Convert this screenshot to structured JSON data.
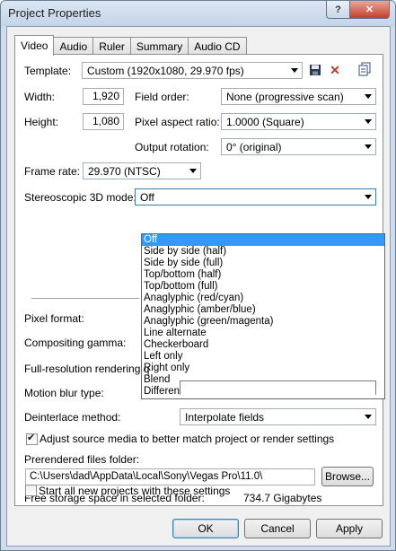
{
  "window": {
    "title": "Project Properties"
  },
  "tabs": [
    {
      "label": "Video",
      "active": true
    },
    {
      "label": "Audio",
      "active": false
    },
    {
      "label": "Ruler",
      "active": false
    },
    {
      "label": "Summary",
      "active": false
    },
    {
      "label": "Audio CD",
      "active": false
    }
  ],
  "video": {
    "template_label": "Template:",
    "template_value": "Custom (1920x1080, 29.970 fps)",
    "width_label": "Width:",
    "width_value": "1,920",
    "height_label": "Height:",
    "height_value": "1,080",
    "field_order_label": "Field order:",
    "field_order_value": "None (progressive scan)",
    "pixel_aspect_label": "Pixel aspect ratio:",
    "pixel_aspect_value": "1.0000 (Square)",
    "output_rotation_label": "Output rotation:",
    "output_rotation_value": "0° (original)",
    "frame_rate_label": "Frame rate:",
    "frame_rate_value": "29.970 (NTSC)",
    "stereo_label": "Stereoscopic 3D mode:",
    "stereo_value": "Off",
    "stereo_options": [
      "Off",
      "Side by side (half)",
      "Side by side (full)",
      "Top/bottom (half)",
      "Top/bottom (full)",
      "Anaglyphic (red/cyan)",
      "Anaglyphic (amber/blue)",
      "Anaglyphic (green/magenta)",
      "Line alternate",
      "Checkerboard",
      "Left only",
      "Right only",
      "Blend",
      "Difference"
    ],
    "pixel_format_label": "Pixel format:",
    "compositing_gamma_label": "Compositing gamma:",
    "full_res_label": "Full-resolution rendering q",
    "motion_blur_label": "Motion blur type:",
    "deinterlace_label": "Deinterlace method:",
    "deinterlace_value": "Interpolate fields",
    "adjust_source_label": "Adjust source media to better match project or render settings",
    "adjust_source_checked": true,
    "prerendered_label": "Prerendered files folder:",
    "prerendered_value": "C:\\Users\\dad\\AppData\\Local\\Sony\\Vegas Pro\\11.0\\",
    "browse_label": "Browse...",
    "free_storage_label": "Free storage space in selected folder:",
    "free_storage_value": "734.7 Gigabytes",
    "start_all_label": "Start all new projects with these settings",
    "start_all_checked": false
  },
  "buttons": {
    "ok": "OK",
    "cancel": "Cancel",
    "apply": "Apply"
  },
  "icons": {
    "save": "save-icon",
    "delete": "delete-icon",
    "copy": "copy-icon",
    "help": "help-icon",
    "close": "close-icon"
  }
}
